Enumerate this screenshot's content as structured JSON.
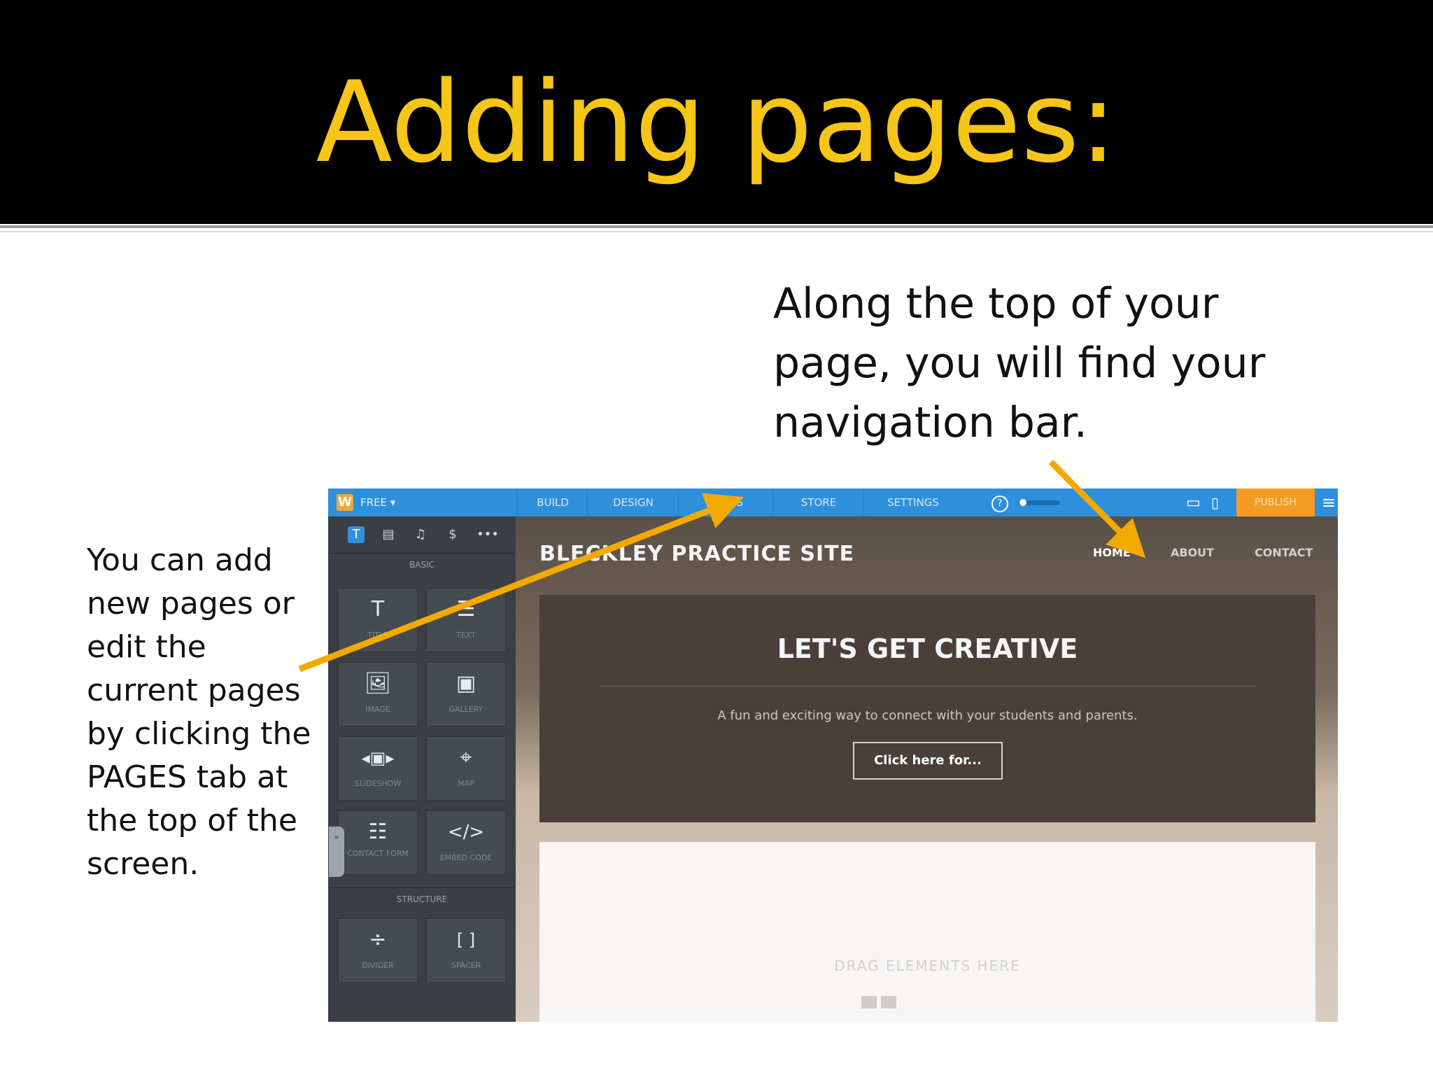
{
  "slide": {
    "title": "Adding pages:",
    "top_text": "Along the top of your page, you will find your navigation bar.",
    "left_text": "You can add new pages or edit the current pages by clicking the PAGES tab at the top of the screen."
  },
  "editor": {
    "logo": "W",
    "plan": "FREE ▾",
    "tabs": [
      "BUILD",
      "DESIGN",
      "PAGES",
      "STORE",
      "SETTINGS"
    ],
    "help": "?",
    "publish": "PUBLISH",
    "sections": {
      "basic": "BASIC",
      "structure": "STRUCTURE"
    },
    "elements": [
      {
        "label": "TITLE",
        "icon": "T"
      },
      {
        "label": "TEXT",
        "icon": "☰"
      },
      {
        "label": "IMAGE",
        "icon": "🖼"
      },
      {
        "label": "GALLERY",
        "icon": "▣"
      },
      {
        "label": "SLIDESHOW",
        "icon": "◂▣▸"
      },
      {
        "label": "MAP",
        "icon": "⌖"
      },
      {
        "label": "CONTACT FORM",
        "icon": "☷"
      },
      {
        "label": "EMBED CODE",
        "icon": "</>"
      },
      {
        "label": "DIVIDER",
        "icon": "÷"
      },
      {
        "label": "SPACER",
        "icon": "[ ]"
      }
    ]
  },
  "site": {
    "title": "BLECKLEY PRACTICE SITE",
    "nav": [
      "HOME",
      "ABOUT",
      "CONTACT"
    ],
    "hero_title": "LET'S GET CREATIVE",
    "hero_subtitle": "A fun and exciting way to connect with your students and parents.",
    "hero_button": "Click here for...",
    "drop_label": "DRAG ELEMENTS HERE"
  },
  "colors": {
    "title_yellow": "#f5c518",
    "arrow_orange": "#f2a900",
    "editor_blue": "#2e8fdc",
    "publish_orange": "#f59b23"
  }
}
